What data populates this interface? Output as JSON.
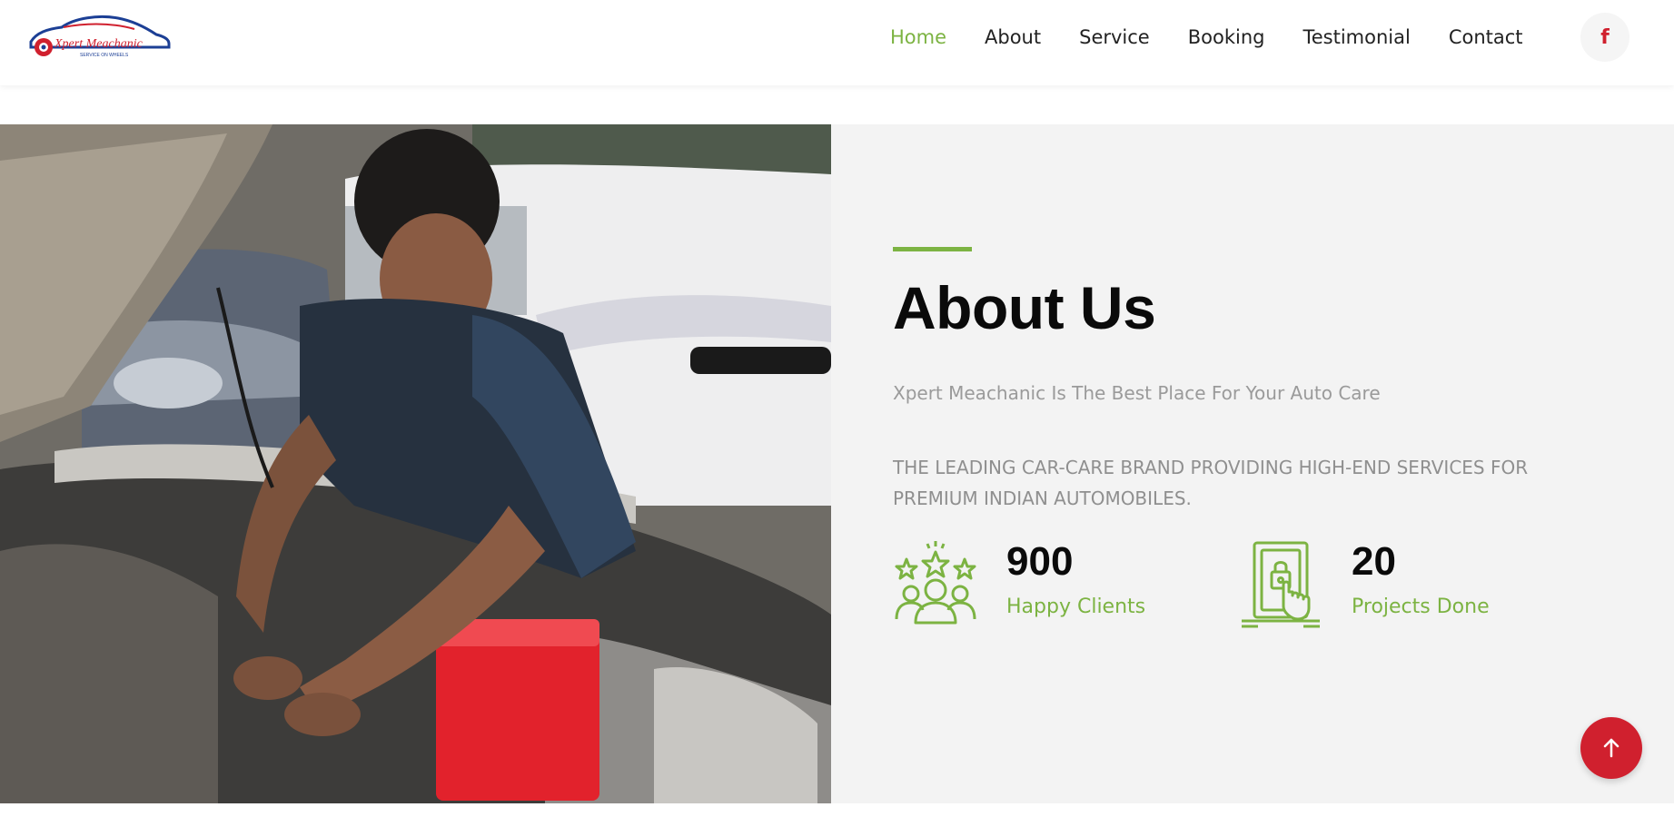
{
  "brand": {
    "name": "Xpert Meachanic",
    "tagline": "SERVICE ON WHEELS",
    "colors": {
      "accent_green": "#7cb342",
      "accent_red": "#d0202e",
      "logo_blue": "#1c3f95"
    }
  },
  "nav": {
    "items": [
      {
        "label": "Home",
        "active": true
      },
      {
        "label": "About",
        "active": false
      },
      {
        "label": "Service",
        "active": false
      },
      {
        "label": "Booking",
        "active": false
      },
      {
        "label": "Testimonial",
        "active": false
      },
      {
        "label": "Contact",
        "active": false
      }
    ],
    "social": {
      "icon": "facebook-icon",
      "glyph": "f"
    }
  },
  "about": {
    "title": "About Us",
    "subtitle": "Xpert Meachanic Is The Best Place For Your Auto Care",
    "description": "THE LEADING CAR-CARE BRAND PROVIDING HIGH-END SERVICES FOR PREMIUM INDIAN AUTOMOBILES.",
    "photo_icon": "mechanic-working-on-car-engine-photo",
    "stats": [
      {
        "icon": "happy-clients-icon",
        "number": "900",
        "label": "Happy Clients"
      },
      {
        "icon": "projects-done-icon",
        "number": "20",
        "label": "Projects Done"
      }
    ]
  },
  "scroll_top": {
    "icon": "arrow-up-icon"
  }
}
